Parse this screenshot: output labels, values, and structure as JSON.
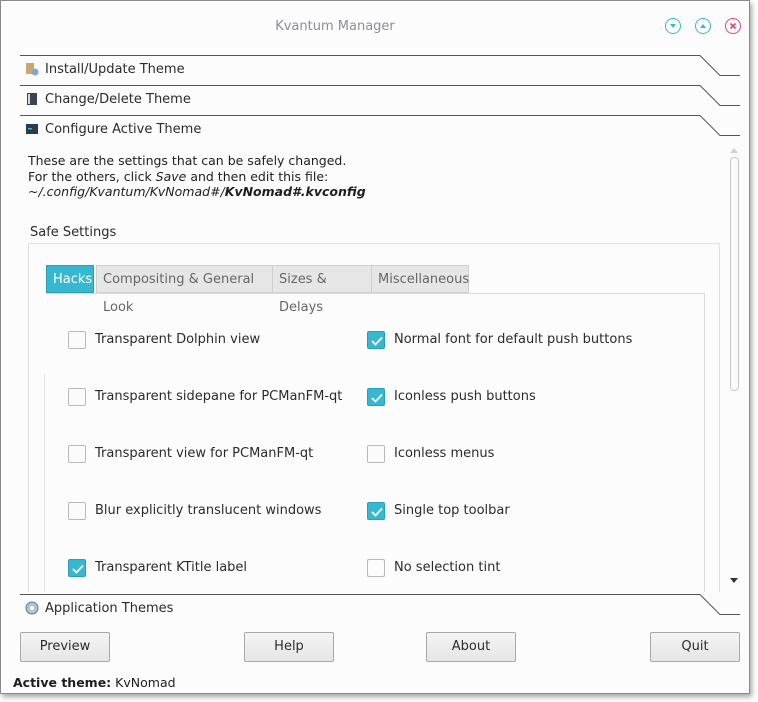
{
  "window": {
    "title": "Kvantum Manager"
  },
  "toolbox": {
    "install": "Install/Update Theme",
    "change": "Change/Delete Theme",
    "configure": "Configure Active Theme",
    "app_themes": "Application Themes"
  },
  "intro": {
    "line1": "These are the settings that can be safely changed.",
    "line2_pre": "For the others, click ",
    "line2_em": "Save",
    "line2_post": " and then edit this file:",
    "path_pre": "~/.config/Kvantum/KvNomad#/",
    "path_file": "KvNomad#.kvconfig"
  },
  "safe_settings": {
    "title": "Safe Settings",
    "tabs": [
      "Hacks",
      "Compositing & General Look",
      "Sizes & Delays",
      "Miscellaneous"
    ],
    "active_tab": "Hacks"
  },
  "hacks": {
    "left": [
      {
        "label": "Transparent Dolphin view",
        "checked": false
      },
      {
        "label": "Transparent sidepane for PCManFM-qt",
        "checked": false
      },
      {
        "label": "Transparent view for PCManFM-qt",
        "checked": false
      },
      {
        "label": "Blur explicitly translucent windows",
        "checked": false
      },
      {
        "label": "Transparent KTitle label",
        "checked": true
      }
    ],
    "right": [
      {
        "label": "Normal font for default push buttons",
        "checked": true
      },
      {
        "label": "Iconless push buttons",
        "checked": true
      },
      {
        "label": "Iconless  menus",
        "checked": false
      },
      {
        "label": "Single top toolbar",
        "checked": true
      },
      {
        "label": "No selection tint",
        "checked": false
      }
    ]
  },
  "buttons": {
    "preview": "Preview",
    "help": "Help",
    "about": "About",
    "quit": "Quit"
  },
  "status": {
    "label": "Active theme:",
    "value": "KvNomad"
  },
  "colors": {
    "accent": "#36b8d3",
    "close": "#e0457b"
  }
}
